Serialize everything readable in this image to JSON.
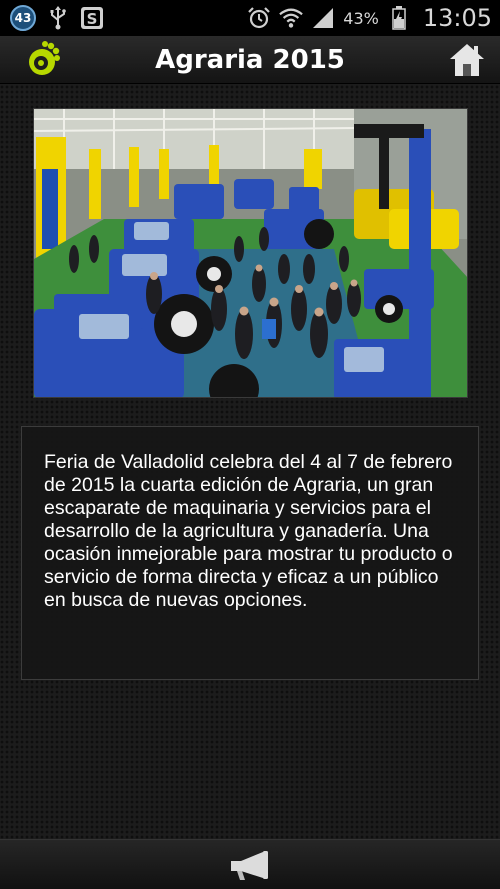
{
  "status_bar": {
    "notification_count": "43",
    "battery_percent": "43%",
    "time": "13:05",
    "icons": [
      "notification-count-icon",
      "usb-icon",
      "s-app-icon",
      "alarm-icon",
      "wifi-icon",
      "signal-icon",
      "battery-icon"
    ]
  },
  "action_bar": {
    "title": "Agraria 2015",
    "logo_icon": "app-logo-icon",
    "home_icon": "home-icon",
    "accent_color": "#b7d800"
  },
  "main": {
    "image_subject": "tractor-exhibition-photo",
    "description": "Feria de Valladolid celebra del 4 al 7 de febrero de 2015 la cuarta edición de Agraria, un gran escaparate de maquinaria y servicios para el desarrollo de la agricultura y ganadería. Una ocasión inmejorable para mostrar tu producto o servicio de forma directa y eficaz a un público en busca de nuevas opciones."
  },
  "bottom_bar": {
    "icon": "megaphone-icon"
  }
}
